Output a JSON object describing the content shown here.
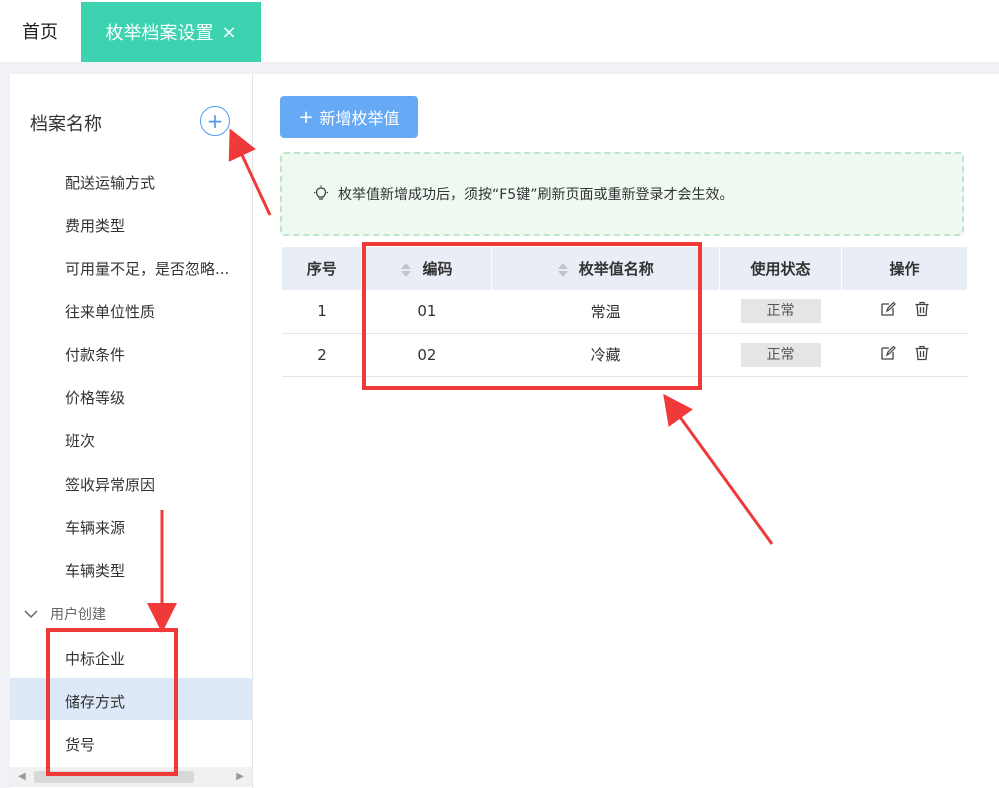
{
  "tabs": {
    "home_label": "首页",
    "active_label": "枚举档案设置",
    "close_glyph": "×"
  },
  "sidebar": {
    "title": "档案名称",
    "add_glyph": "+",
    "items": [
      "配送运输方式",
      "费用类型",
      "可用量不足，是否忽略...",
      "往来单位性质",
      "付款条件",
      "价格等级",
      "班次",
      "签收异常原因",
      "车辆来源",
      "车辆类型"
    ],
    "group_label": "用户创建",
    "user_items": [
      "中标企业",
      "储存方式",
      "货号"
    ],
    "selected_user_item_index": 1
  },
  "main": {
    "add_button_label": "新增枚举值",
    "notice_text": "枚举值新增成功后，须按“F5键”刷新页面或重新登录才会生效。"
  },
  "table": {
    "headers": [
      "序号",
      "编码",
      "枚举值名称",
      "使用状态",
      "操作"
    ],
    "rows": [
      {
        "index": "1",
        "code": "01",
        "name": "常温",
        "status": "正常"
      },
      {
        "index": "2",
        "code": "02",
        "name": "冷藏",
        "status": "正常"
      }
    ]
  },
  "colors": {
    "tab_active": "#3dd2b0",
    "button_primary": "#66aaf5",
    "annotation_red": "#f03a3a",
    "selected_row": "#dde9f8"
  },
  "icons": [
    "plus-icon",
    "chevron-down-icon",
    "bulb-icon",
    "sort-icon",
    "edit-icon",
    "delete-icon",
    "close-icon"
  ]
}
